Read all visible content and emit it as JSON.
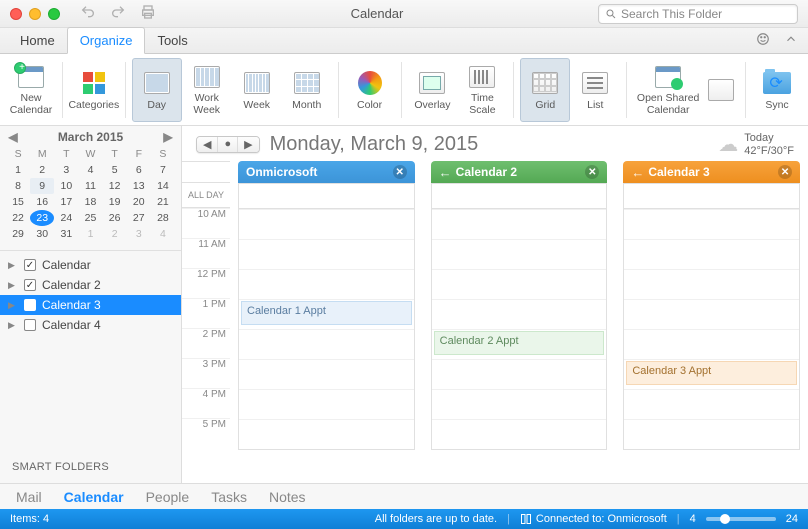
{
  "window": {
    "title": "Calendar"
  },
  "search": {
    "placeholder": "Search This Folder"
  },
  "tabs": {
    "home": "Home",
    "organize": "Organize",
    "tools": "Tools"
  },
  "ribbon": {
    "new_cal": "New\nCalendar",
    "categories": "Categories",
    "day": "Day",
    "work_week": "Work\nWeek",
    "week": "Week",
    "month": "Month",
    "color": "Color",
    "overlay": "Overlay",
    "time_scale": "Time\nScale",
    "grid": "Grid",
    "list": "List",
    "open_shared": "Open Shared\nCalendar",
    "sync": "Sync"
  },
  "mini_cal": {
    "title": "March 2015",
    "dow": [
      "S",
      "M",
      "T",
      "W",
      "T",
      "F",
      "S"
    ],
    "cells": [
      {
        "t": "1"
      },
      {
        "t": "2"
      },
      {
        "t": "3"
      },
      {
        "t": "4"
      },
      {
        "t": "5"
      },
      {
        "t": "6"
      },
      {
        "t": "7"
      },
      {
        "t": "8"
      },
      {
        "t": "9",
        "sel": true
      },
      {
        "t": "10"
      },
      {
        "t": "11"
      },
      {
        "t": "12"
      },
      {
        "t": "13"
      },
      {
        "t": "14"
      },
      {
        "t": "15"
      },
      {
        "t": "16"
      },
      {
        "t": "17"
      },
      {
        "t": "18"
      },
      {
        "t": "19"
      },
      {
        "t": "20"
      },
      {
        "t": "21"
      },
      {
        "t": "22"
      },
      {
        "t": "23",
        "today": true
      },
      {
        "t": "24"
      },
      {
        "t": "25"
      },
      {
        "t": "26"
      },
      {
        "t": "27"
      },
      {
        "t": "28"
      },
      {
        "t": "29"
      },
      {
        "t": "30"
      },
      {
        "t": "31"
      },
      {
        "t": "1",
        "dim": true
      },
      {
        "t": "2",
        "dim": true
      },
      {
        "t": "3",
        "dim": true
      },
      {
        "t": "4",
        "dim": true
      }
    ]
  },
  "calendars": [
    {
      "name": "Calendar",
      "checked": true,
      "active": false
    },
    {
      "name": "Calendar 2",
      "checked": true,
      "active": false
    },
    {
      "name": "Calendar 3",
      "checked": true,
      "active": true
    },
    {
      "name": "Calendar 4",
      "checked": false,
      "active": false
    }
  ],
  "smart_folders": "SMART FOLDERS",
  "header": {
    "date": "Monday, March 9, 2015",
    "weather_label": "Today",
    "weather_temp": "42°F/30°F"
  },
  "allday_label": "ALL DAY",
  "hours": [
    "10 AM",
    "11 AM",
    "12 PM",
    "1 PM",
    "2 PM",
    "3 PM",
    "4 PM",
    "5 PM"
  ],
  "columns": [
    {
      "title": "Onmicrosoft",
      "arrow": false
    },
    {
      "title": "Calendar 2",
      "arrow": true
    },
    {
      "title": "Calendar 3",
      "arrow": true
    }
  ],
  "events": {
    "c1": "Calendar 1 Appt",
    "c2": "Calendar 2 Appt",
    "c3": "Calendar 3 Appt"
  },
  "bottom": {
    "mail": "Mail",
    "calendar": "Calendar",
    "people": "People",
    "tasks": "Tasks",
    "notes": "Notes"
  },
  "status": {
    "items": "Items: 4",
    "uptodate": "All folders are up to date.",
    "connected": "Connected to: Onmicrosoft",
    "zmin": "4",
    "zmax": "24"
  }
}
